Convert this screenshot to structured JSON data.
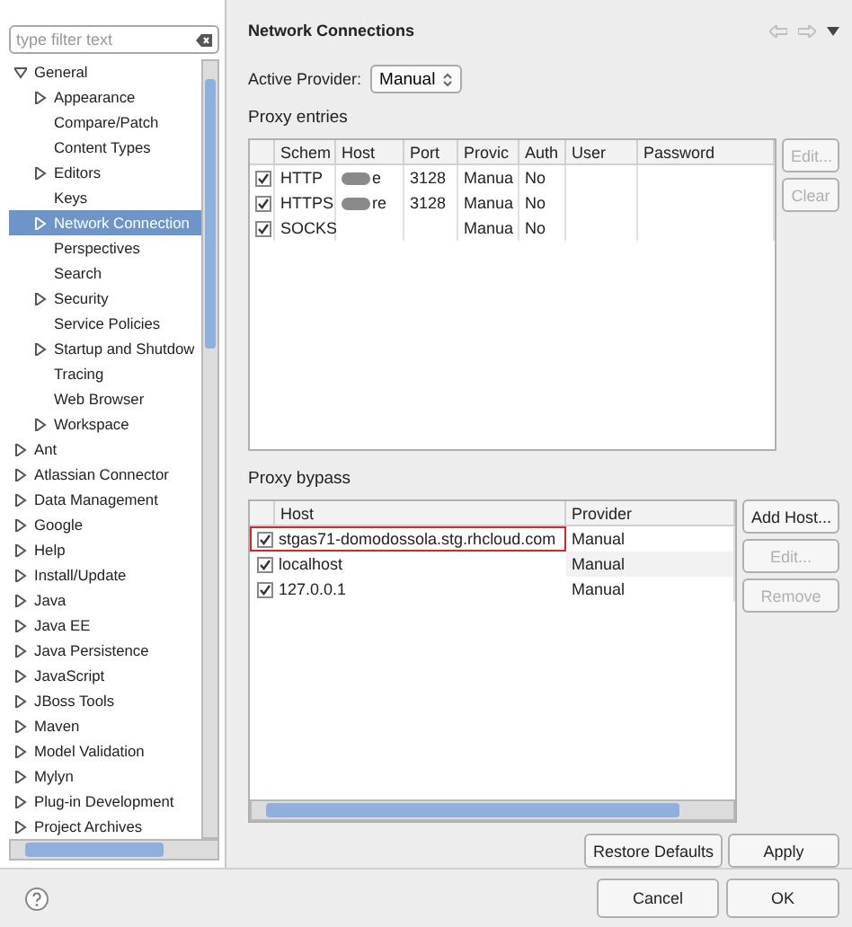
{
  "filter": {
    "placeholder": "type filter text"
  },
  "tree": [
    {
      "label": "General",
      "expanded": true,
      "selected": false,
      "children": [
        {
          "label": "Appearance",
          "expanded": false,
          "selected": false
        },
        {
          "label": "Compare/Patch",
          "selected": false
        },
        {
          "label": "Content Types",
          "selected": false
        },
        {
          "label": "Editors",
          "expanded": false,
          "selected": false
        },
        {
          "label": "Keys",
          "selected": false
        },
        {
          "label": "Network Connection",
          "expanded": false,
          "selected": true
        },
        {
          "label": "Perspectives",
          "selected": false
        },
        {
          "label": "Search",
          "selected": false
        },
        {
          "label": "Security",
          "expanded": false,
          "selected": false
        },
        {
          "label": "Service Policies",
          "selected": false
        },
        {
          "label": "Startup and Shutdow",
          "expanded": false,
          "selected": false
        },
        {
          "label": "Tracing",
          "selected": false
        },
        {
          "label": "Web Browser",
          "selected": false
        },
        {
          "label": "Workspace",
          "expanded": false,
          "selected": false
        }
      ]
    },
    {
      "label": "Ant",
      "expanded": false,
      "selected": false
    },
    {
      "label": "Atlassian Connector",
      "expanded": false,
      "selected": false
    },
    {
      "label": "Data Management",
      "expanded": false,
      "selected": false
    },
    {
      "label": "Google",
      "expanded": false,
      "selected": false
    },
    {
      "label": "Help",
      "expanded": false,
      "selected": false
    },
    {
      "label": "Install/Update",
      "expanded": false,
      "selected": false
    },
    {
      "label": "Java",
      "expanded": false,
      "selected": false
    },
    {
      "label": "Java EE",
      "expanded": false,
      "selected": false
    },
    {
      "label": "Java Persistence",
      "expanded": false,
      "selected": false
    },
    {
      "label": "JavaScript",
      "expanded": false,
      "selected": false
    },
    {
      "label": "JBoss Tools",
      "expanded": false,
      "selected": false
    },
    {
      "label": "Maven",
      "expanded": false,
      "selected": false
    },
    {
      "label": "Model Validation",
      "expanded": false,
      "selected": false
    },
    {
      "label": "Mylyn",
      "expanded": false,
      "selected": false
    },
    {
      "label": "Plug-in Development",
      "expanded": false,
      "selected": false
    },
    {
      "label": "Project Archives",
      "expanded": false,
      "selected": false
    }
  ],
  "page_title": "Network Connections",
  "active_provider": {
    "label": "Active Provider:",
    "value": "Manual"
  },
  "proxy_entries": {
    "title": "Proxy entries",
    "columns": [
      "Schem",
      "Host",
      "Port",
      "Provic",
      "Auth",
      "User",
      "Password"
    ],
    "rows": [
      {
        "checked": true,
        "cells": [
          "HTTP",
          "e",
          "3128",
          "Manua",
          "No",
          "",
          ""
        ]
      },
      {
        "checked": true,
        "cells": [
          "HTTPS",
          "re",
          "3128",
          "Manua",
          "No",
          "",
          ""
        ]
      },
      {
        "checked": true,
        "cells": [
          "SOCKS",
          "",
          "",
          "Manua",
          "No",
          "",
          ""
        ]
      }
    ],
    "buttons": [
      {
        "label": "Edit...",
        "disabled": true
      },
      {
        "label": "Clear",
        "disabled": true
      }
    ]
  },
  "proxy_bypass": {
    "title": "Proxy bypass",
    "columns": [
      "Host",
      "Provider"
    ],
    "rows": [
      {
        "checked": true,
        "highlighted": true,
        "host": "stgas71-domodossola.stg.rhcloud.com",
        "provider": "Manual"
      },
      {
        "checked": true,
        "highlighted": false,
        "host": "localhost",
        "provider": "Manual"
      },
      {
        "checked": true,
        "highlighted": false,
        "host": "127.0.0.1",
        "provider": "Manual"
      }
    ],
    "buttons": [
      {
        "label": "Add Host...",
        "disabled": false
      },
      {
        "label": "Edit...",
        "disabled": true
      },
      {
        "label": "Remove",
        "disabled": true
      }
    ]
  },
  "page_buttons": [
    "Restore Defaults",
    "Apply"
  ],
  "dialog_buttons": [
    "Cancel",
    "OK"
  ]
}
